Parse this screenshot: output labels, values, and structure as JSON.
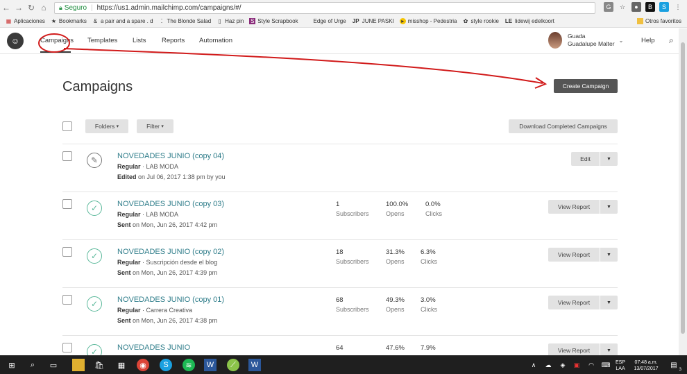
{
  "browser": {
    "secure_label": "Seguro",
    "url": "https://us1.admin.mailchimp.com/campaigns/#/",
    "bookmarks": [
      {
        "label": "Aplicaciones",
        "icon": "apps-grid-icon"
      },
      {
        "label": "Bookmarks",
        "icon": "star-icon"
      },
      {
        "label": "a pair and a spare . d",
        "icon": "ampersand-icon"
      },
      {
        "label": "The Blonde Salad",
        "icon": "dots-icon"
      },
      {
        "label": "Haz pin",
        "icon": "page-icon"
      },
      {
        "label": "Style Scrapbook",
        "icon": "s-badge-icon"
      },
      {
        "label": "Edge of Urge",
        "icon": ""
      },
      {
        "label": "JUNE PASKI",
        "icon": "jp-icon"
      },
      {
        "label": "misshop - Pedestria",
        "icon": "yellow-dot-icon"
      },
      {
        "label": "style rookie",
        "icon": "flower-icon"
      },
      {
        "label": "lidewij edelkoort",
        "icon": "le-icon"
      }
    ],
    "other_bookmarks": "Otros favoritos"
  },
  "nav": {
    "items": [
      "Campaigns",
      "Templates",
      "Lists",
      "Reports",
      "Automation"
    ],
    "user_first": "Guada",
    "user_full": "Guadalupe Malter",
    "help": "Help"
  },
  "page": {
    "title": "Campaigns",
    "create_button": "Create Campaign",
    "folders_button": "Folders",
    "filter_button": "Filter",
    "download_button": "Download Completed Campaigns"
  },
  "campaigns": [
    {
      "title": "NOVEDADES JUNIO (copy 04)",
      "type": "Regular",
      "list": "· LAB MODA",
      "when_label": "Edited",
      "when": "on Jul 06, 2017 1:38 pm by you",
      "status": "draft",
      "action": "Edit"
    },
    {
      "title": "NOVEDADES JUNIO (copy 03)",
      "type": "Regular",
      "list": "· LAB MODA",
      "when_label": "Sent",
      "when": "on Mon, Jun 26, 2017 4:42 pm",
      "status": "sent",
      "subscribers": "1",
      "subscribers_label": "Subscribers",
      "opens": "100.0%",
      "opens_label": "Opens",
      "clicks": "0.0%",
      "clicks_label": "Clicks",
      "action": "View Report"
    },
    {
      "title": "NOVEDADES JUNIO (copy 02)",
      "type": "Regular",
      "list": "· Suscripción desde el blog",
      "when_label": "Sent",
      "when": "on Mon, Jun 26, 2017 4:39 pm",
      "status": "sent",
      "subscribers": "18",
      "subscribers_label": "Subscribers",
      "opens": "31.3%",
      "opens_label": "Opens",
      "clicks": "6.3%",
      "clicks_label": "Clicks",
      "action": "View Report"
    },
    {
      "title": "NOVEDADES JUNIO (copy 01)",
      "type": "Regular",
      "list": "· Carrera Creativa",
      "when_label": "Sent",
      "when": "on Mon, Jun 26, 2017 4:38 pm",
      "status": "sent",
      "subscribers": "68",
      "subscribers_label": "Subscribers",
      "opens": "49.3%",
      "opens_label": "Opens",
      "clicks": "3.0%",
      "clicks_label": "Clicks",
      "action": "View Report"
    },
    {
      "title": "NOVEDADES JUNIO",
      "status": "sent",
      "subscribers": "64",
      "opens": "47.6%",
      "clicks": "7.9%",
      "action": "View Report"
    }
  ],
  "taskbar": {
    "lang_top": "ESP",
    "lang_bottom": "LAA",
    "time": "07:48 a.m.",
    "date": "13/07/2017",
    "notif_count": "3"
  },
  "colors": {
    "accent_link": "#2f7d8a",
    "sent_green": "#5ab89a",
    "dark_button": "#555555",
    "annotation_red": "#d11a1a"
  }
}
